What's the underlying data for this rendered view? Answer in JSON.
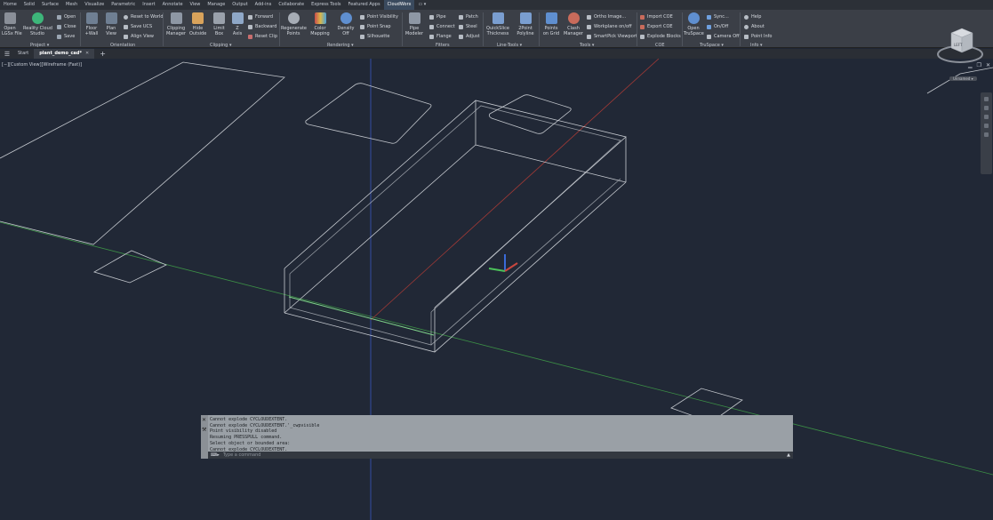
{
  "menu": {
    "tabs": [
      "Home",
      "Solid",
      "Surface",
      "Mesh",
      "Visualize",
      "Parametric",
      "Insert",
      "Annotate",
      "View",
      "Manage",
      "Output",
      "Add-ins",
      "Collaborate",
      "Express Tools",
      "Featured Apps",
      "CloudWorx",
      "▭ ▾"
    ],
    "active": "CloudWorx"
  },
  "ribbon": {
    "project": {
      "title": "Project ▾",
      "open_lgsx": "Open\nLGSx File",
      "reality_cloud": "Reality Cloud\nStudio",
      "open": "Open",
      "close": "Close",
      "save": "Save"
    },
    "orientation": {
      "title": "Orientation",
      "floor_wall": "Floor\n+Wall",
      "plan_view": "Plan\nView",
      "reset_world": "Reset to World",
      "save_ucs": "Save UCS",
      "align_view": "Align View"
    },
    "clipping": {
      "title": "Clipping ▾",
      "clipping_manager": "Clipping\nManager",
      "hide_outside": "Hide\nOutside",
      "limit_box": "Limit\nBox",
      "z_axis": "Z\nAxis",
      "forward": "Forward",
      "backward": "Backward",
      "reset_clip": "Reset Clip"
    },
    "rendering": {
      "title": "Rendering ▾",
      "regenerate": "Regenerate\nPoints",
      "color_mapping": "Color\nMapping",
      "density": "Density\nOff",
      "point_visibility": "Point Visibility",
      "point_snap": "Point Snap",
      "silhouette": "Silhouette"
    },
    "fitters": {
      "title": "Fitters",
      "pipe_modeler": "Pipe\nModeler",
      "pipe": "Pipe",
      "connect": "Connect",
      "flange": "Flange",
      "patch": "Patch",
      "steel": "Steel",
      "adjust": "Adjust"
    },
    "linetools": {
      "title": "Line-Tools ▾",
      "quickslice": "QuickSlice\nThickness",
      "polyline": "2Point\nPolyline"
    },
    "tools": {
      "title": "Tools ▾",
      "points_grid": "Points\non Grid",
      "clash": "Clash\nManager",
      "ortho": "Ortho Image...",
      "workplane": "Workplane on/off",
      "smartpick": "SmartPick Viewport"
    },
    "coe": {
      "title": "COE",
      "import": "Import COE",
      "export": "Export COE",
      "explode": "Explode Blocks"
    },
    "truspace": {
      "title": "TruSpace ▾",
      "open": "Open\nTruSpace",
      "sync": "Sync...",
      "onoff": "On/Off",
      "camera": "Camera Off"
    },
    "info": {
      "title": "Info ▾",
      "help": "Help",
      "about": "About",
      "point_info": "Point Info"
    }
  },
  "doc_tabs": {
    "start": "Start",
    "active": "plant_demo_cad*",
    "close_glyph": "✕",
    "add_glyph": "+"
  },
  "viewport": {
    "label": "[−][Custom View][Wireframe (Fast)]",
    "viewcube_face": "LEFT",
    "viewcube_dropdown": "Unnamed ▾"
  },
  "command": {
    "history": [
      "Cannot explode CYCLOUDEXTENT.",
      "Cannot explode CYCLOUDEXTENT.'_cwpvisible",
      "Point visibility disabled",
      "Resuming PRESSPULL command.",
      "Select object or bounded area:",
      "Cannot explode CYCLOUDEXTENT."
    ],
    "placeholder": "Type a command",
    "prompt_glyph": "⌨▸"
  },
  "colors": {
    "accent": "#3a4a5e",
    "viewport_bg": "#212836",
    "wire": "#c8ccd2",
    "axis_green": "#3fb14a",
    "axis_red": "#c0443c",
    "axis_blue": "#4a6ad8"
  }
}
